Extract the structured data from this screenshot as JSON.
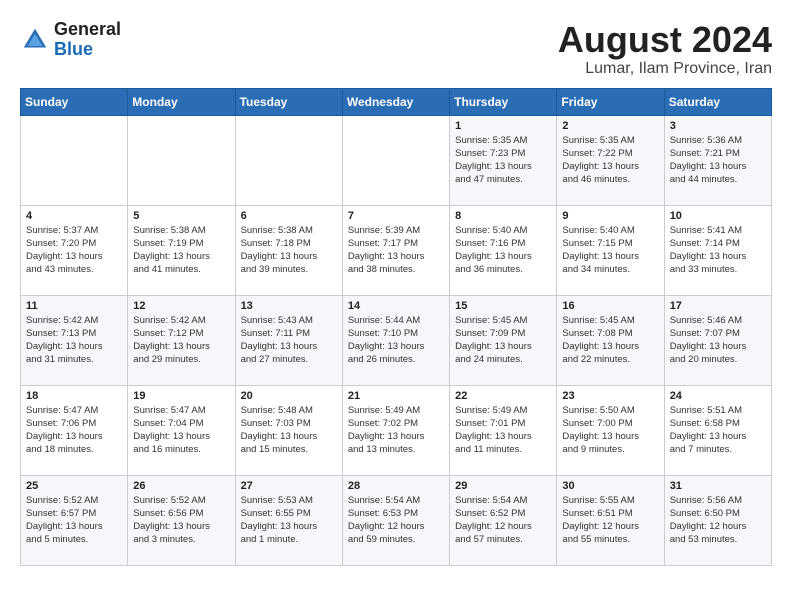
{
  "header": {
    "logo_general": "General",
    "logo_blue": "Blue",
    "month_year": "August 2024",
    "location": "Lumar, Ilam Province, Iran"
  },
  "weekdays": [
    "Sunday",
    "Monday",
    "Tuesday",
    "Wednesday",
    "Thursday",
    "Friday",
    "Saturday"
  ],
  "weeks": [
    [
      {
        "day": "",
        "content": ""
      },
      {
        "day": "",
        "content": ""
      },
      {
        "day": "",
        "content": ""
      },
      {
        "day": "",
        "content": ""
      },
      {
        "day": "1",
        "content": "Sunrise: 5:35 AM\nSunset: 7:23 PM\nDaylight: 13 hours\nand 47 minutes."
      },
      {
        "day": "2",
        "content": "Sunrise: 5:35 AM\nSunset: 7:22 PM\nDaylight: 13 hours\nand 46 minutes."
      },
      {
        "day": "3",
        "content": "Sunrise: 5:36 AM\nSunset: 7:21 PM\nDaylight: 13 hours\nand 44 minutes."
      }
    ],
    [
      {
        "day": "4",
        "content": "Sunrise: 5:37 AM\nSunset: 7:20 PM\nDaylight: 13 hours\nand 43 minutes."
      },
      {
        "day": "5",
        "content": "Sunrise: 5:38 AM\nSunset: 7:19 PM\nDaylight: 13 hours\nand 41 minutes."
      },
      {
        "day": "6",
        "content": "Sunrise: 5:38 AM\nSunset: 7:18 PM\nDaylight: 13 hours\nand 39 minutes."
      },
      {
        "day": "7",
        "content": "Sunrise: 5:39 AM\nSunset: 7:17 PM\nDaylight: 13 hours\nand 38 minutes."
      },
      {
        "day": "8",
        "content": "Sunrise: 5:40 AM\nSunset: 7:16 PM\nDaylight: 13 hours\nand 36 minutes."
      },
      {
        "day": "9",
        "content": "Sunrise: 5:40 AM\nSunset: 7:15 PM\nDaylight: 13 hours\nand 34 minutes."
      },
      {
        "day": "10",
        "content": "Sunrise: 5:41 AM\nSunset: 7:14 PM\nDaylight: 13 hours\nand 33 minutes."
      }
    ],
    [
      {
        "day": "11",
        "content": "Sunrise: 5:42 AM\nSunset: 7:13 PM\nDaylight: 13 hours\nand 31 minutes."
      },
      {
        "day": "12",
        "content": "Sunrise: 5:42 AM\nSunset: 7:12 PM\nDaylight: 13 hours\nand 29 minutes."
      },
      {
        "day": "13",
        "content": "Sunrise: 5:43 AM\nSunset: 7:11 PM\nDaylight: 13 hours\nand 27 minutes."
      },
      {
        "day": "14",
        "content": "Sunrise: 5:44 AM\nSunset: 7:10 PM\nDaylight: 13 hours\nand 26 minutes."
      },
      {
        "day": "15",
        "content": "Sunrise: 5:45 AM\nSunset: 7:09 PM\nDaylight: 13 hours\nand 24 minutes."
      },
      {
        "day": "16",
        "content": "Sunrise: 5:45 AM\nSunset: 7:08 PM\nDaylight: 13 hours\nand 22 minutes."
      },
      {
        "day": "17",
        "content": "Sunrise: 5:46 AM\nSunset: 7:07 PM\nDaylight: 13 hours\nand 20 minutes."
      }
    ],
    [
      {
        "day": "18",
        "content": "Sunrise: 5:47 AM\nSunset: 7:06 PM\nDaylight: 13 hours\nand 18 minutes."
      },
      {
        "day": "19",
        "content": "Sunrise: 5:47 AM\nSunset: 7:04 PM\nDaylight: 13 hours\nand 16 minutes."
      },
      {
        "day": "20",
        "content": "Sunrise: 5:48 AM\nSunset: 7:03 PM\nDaylight: 13 hours\nand 15 minutes."
      },
      {
        "day": "21",
        "content": "Sunrise: 5:49 AM\nSunset: 7:02 PM\nDaylight: 13 hours\nand 13 minutes."
      },
      {
        "day": "22",
        "content": "Sunrise: 5:49 AM\nSunset: 7:01 PM\nDaylight: 13 hours\nand 11 minutes."
      },
      {
        "day": "23",
        "content": "Sunrise: 5:50 AM\nSunset: 7:00 PM\nDaylight: 13 hours\nand 9 minutes."
      },
      {
        "day": "24",
        "content": "Sunrise: 5:51 AM\nSunset: 6:58 PM\nDaylight: 13 hours\nand 7 minutes."
      }
    ],
    [
      {
        "day": "25",
        "content": "Sunrise: 5:52 AM\nSunset: 6:57 PM\nDaylight: 13 hours\nand 5 minutes."
      },
      {
        "day": "26",
        "content": "Sunrise: 5:52 AM\nSunset: 6:56 PM\nDaylight: 13 hours\nand 3 minutes."
      },
      {
        "day": "27",
        "content": "Sunrise: 5:53 AM\nSunset: 6:55 PM\nDaylight: 13 hours\nand 1 minute."
      },
      {
        "day": "28",
        "content": "Sunrise: 5:54 AM\nSunset: 6:53 PM\nDaylight: 12 hours\nand 59 minutes."
      },
      {
        "day": "29",
        "content": "Sunrise: 5:54 AM\nSunset: 6:52 PM\nDaylight: 12 hours\nand 57 minutes."
      },
      {
        "day": "30",
        "content": "Sunrise: 5:55 AM\nSunset: 6:51 PM\nDaylight: 12 hours\nand 55 minutes."
      },
      {
        "day": "31",
        "content": "Sunrise: 5:56 AM\nSunset: 6:50 PM\nDaylight: 12 hours\nand 53 minutes."
      }
    ]
  ]
}
